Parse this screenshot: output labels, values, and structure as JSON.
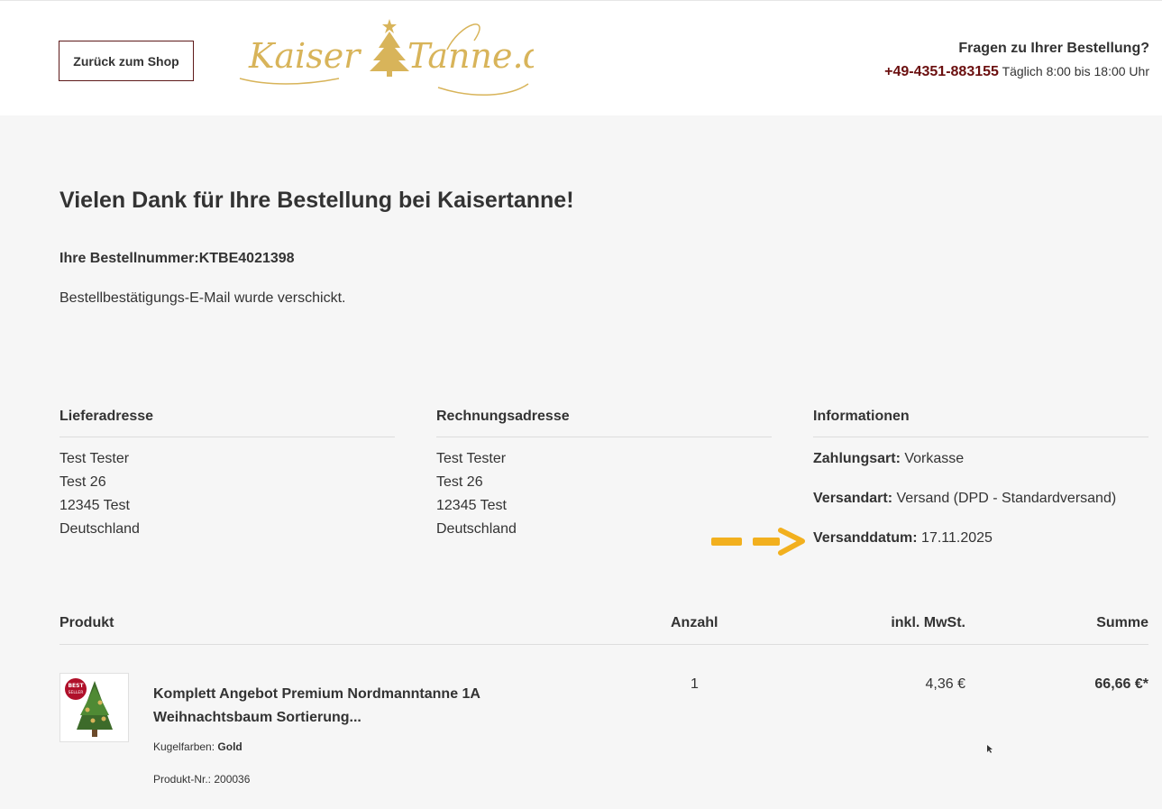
{
  "header": {
    "back_button": "Zurück zum Shop",
    "logo_text": "KaiserTanne.de",
    "help_title": "Fragen zu Ihrer Bestellung?",
    "phone": "+49-4351-883155",
    "hours": "Täglich 8:00 bis 18:00 Uhr"
  },
  "confirmation": {
    "title": "Vielen Dank für Ihre Bestellung bei Kaisertanne!",
    "order_number": "Ihre Bestellnummer:KTBE4021398",
    "mail_sent": "Bestellbestätigungs-E-Mail wurde verschickt."
  },
  "delivery": {
    "heading": "Lieferadresse",
    "lines": [
      "Test Tester",
      "Test 26",
      "12345 Test",
      "Deutschland"
    ]
  },
  "billing": {
    "heading": "Rechnungsadresse",
    "lines": [
      "Test Tester",
      "Test 26",
      "12345 Test",
      "Deutschland"
    ]
  },
  "info": {
    "heading": "Informationen",
    "payment_label": "Zahlungsart:",
    "payment_value": "Vorkasse",
    "shipping_label": "Versandart:",
    "shipping_value": "Versand (DPD - Standardversand)",
    "date_label": "Versanddatum:",
    "date_value": "17.11.2025"
  },
  "table": {
    "headers": {
      "product": "Produkt",
      "quantity": "Anzahl",
      "vat": "inkl. MwSt.",
      "sum": "Summe"
    },
    "rows": [
      {
        "name": "Komplett Angebot Premium Nordmanntanne 1A Weihnachtsbaum Sortierung...",
        "option_label": "Kugelfarben:",
        "option_value": "Gold",
        "product_nr": "Produkt-Nr.: 200036",
        "badge": "BEST SELLER",
        "quantity": "1",
        "vat": "4,36 €",
        "sum": "66,66 €*"
      }
    ]
  },
  "colors": {
    "accent": "#6b0f0f",
    "gold": "#d8b45a",
    "arrow": "#f2b01e",
    "background": "#f6f6f6"
  }
}
